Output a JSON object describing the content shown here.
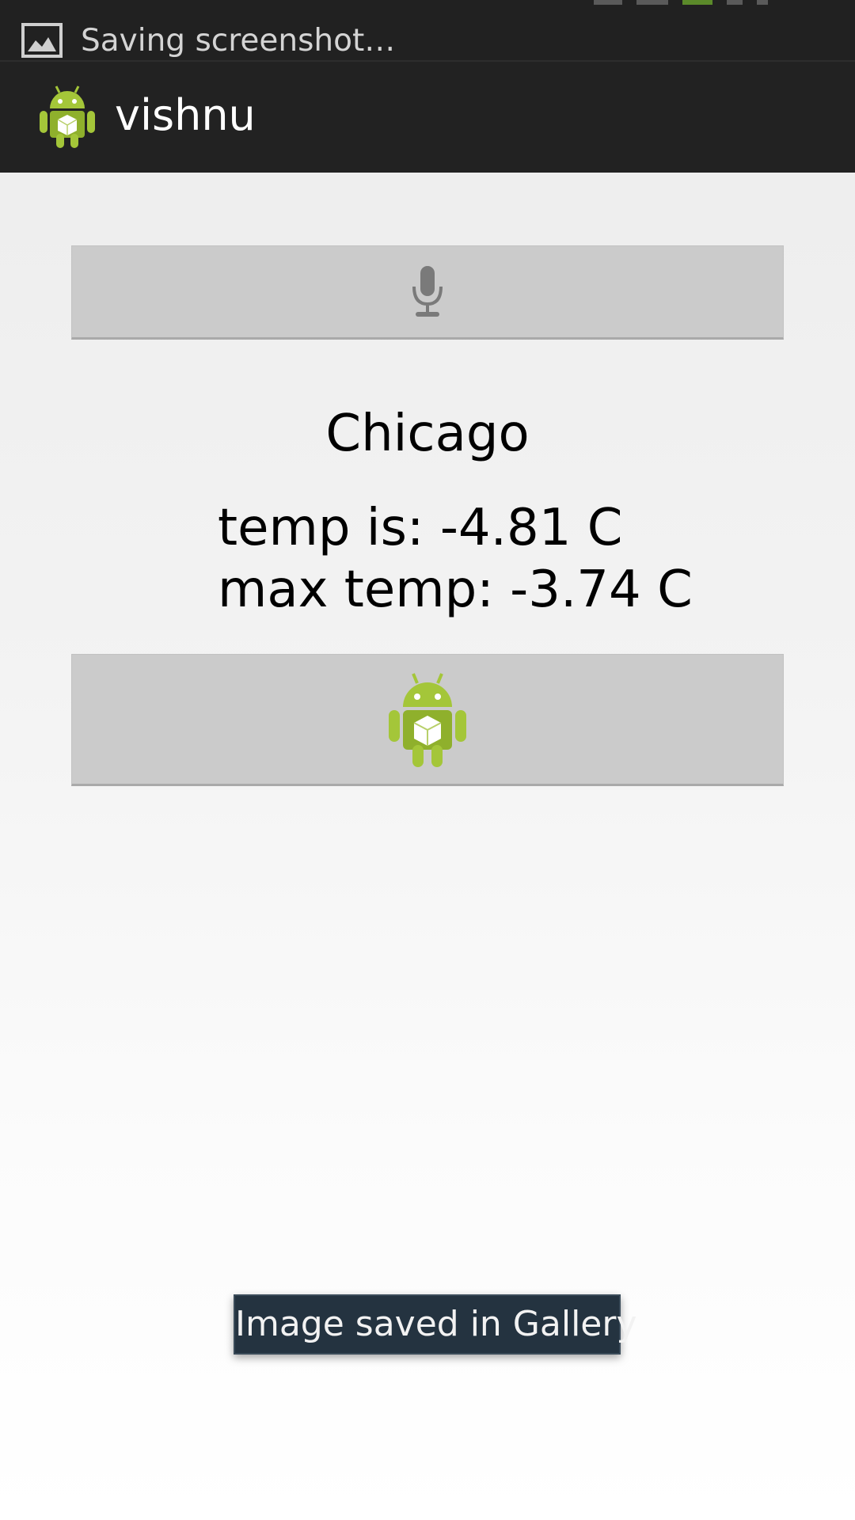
{
  "status_bar": {
    "notification_text": "Saving screenshot…",
    "notification_icon": "image-icon"
  },
  "action_bar": {
    "app_icon": "android-app-icon",
    "title": "vishnu"
  },
  "content": {
    "mic_button_icon": "microphone-icon",
    "city": "Chicago",
    "temp_line": "temp is: -4.81 C",
    "max_temp_line": "max temp: -3.74 C",
    "android_button_icon": "android-robot-icon"
  },
  "toast": {
    "text": "Image saved in Gallery"
  },
  "colors": {
    "status_bar_bg": "#212121",
    "action_bar_bg": "#222222",
    "button_bg": "#cbcbcb",
    "android_green": "#a4c639",
    "toast_bg": "#243340"
  }
}
